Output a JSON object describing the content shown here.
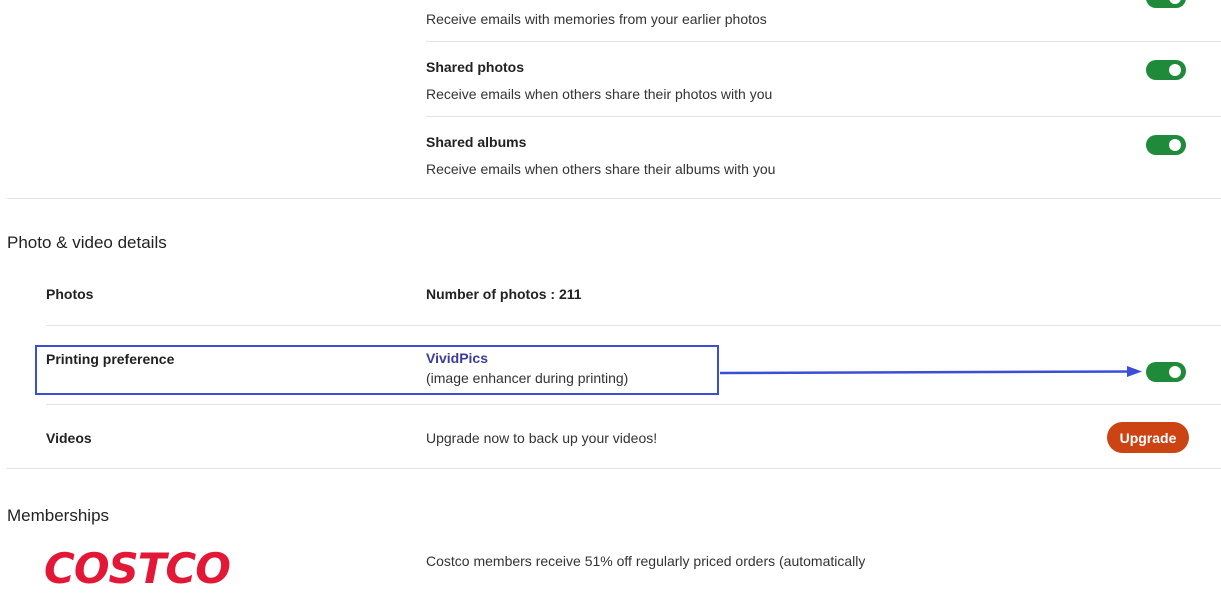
{
  "notifications": {
    "memories": {
      "description": "Receive emails with memories from your earlier photos",
      "enabled": true
    },
    "shared_photos": {
      "title": "Shared photos",
      "description": "Receive emails when others share their photos with you",
      "enabled": true
    },
    "shared_albums": {
      "title": "Shared albums",
      "description": "Receive emails when others share their albums with you",
      "enabled": true
    }
  },
  "photo_video_details": {
    "title": "Photo & video details",
    "photos": {
      "label": "Photos",
      "count_label": "Number of photos :",
      "count_value": "211"
    },
    "printing_preference": {
      "label": "Printing preference",
      "service_name": "VividPics",
      "service_note": "(image enhancer during printing)",
      "enabled": true
    },
    "videos": {
      "label": "Videos",
      "message": "Upgrade now to back up your videos!",
      "upgrade_label": "Upgrade"
    }
  },
  "memberships": {
    "title": "Memberships",
    "logo_text": "COSTCO",
    "description": "Costco members receive 51% off regularly priced orders (automatically"
  },
  "colors": {
    "toggle_on": "#1f8a3a",
    "upgrade_button": "#cc4414",
    "annotation_blue": "#3a4fd6",
    "costco_red": "#e31837"
  },
  "icons": {
    "arrow": "arrow-right-icon"
  }
}
